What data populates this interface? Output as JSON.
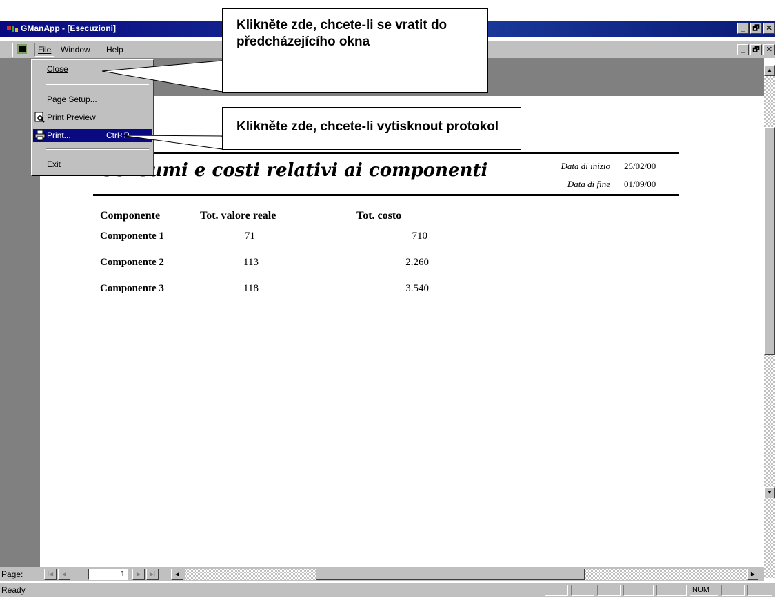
{
  "window": {
    "title": "GManApp - [Esecuzioni]",
    "controls": [
      "_",
      "🗗",
      "✕"
    ]
  },
  "menubar": {
    "file": "File",
    "window": "Window",
    "help": "Help"
  },
  "file_menu": {
    "close": "Close",
    "page_setup": "Page Setup...",
    "print_preview": "Print Preview",
    "print": "Print...",
    "print_shortcut": "Ctrl+P",
    "exit": "Exit"
  },
  "callouts": {
    "close_hint": "Klikněte zde, chcete-li se vratit do předcházejícího okna",
    "print_hint": "Klikněte zde, chcete-li vytisknout protokol"
  },
  "report": {
    "title": "Consumi e costi relativi ai componenti",
    "start_label": "Data di inizio",
    "start_value": "25/02/00",
    "end_label": "Data di fine",
    "end_value": "01/09/00",
    "columns": [
      "Componente",
      "Tot. valore reale",
      "Tot. costo"
    ],
    "rows": [
      {
        "name": "Componente 1",
        "value": "71",
        "cost": "710"
      },
      {
        "name": "Componente 2",
        "value": "113",
        "cost": "2.260"
      },
      {
        "name": "Componente 3",
        "value": "118",
        "cost": "3.540"
      }
    ]
  },
  "navigation": {
    "page_label": "Page:",
    "page_value": "1"
  },
  "status": {
    "text": "Ready",
    "num": "NUM"
  },
  "colors": {
    "title_bar": "#0a0a80",
    "face": "#c0c0c0",
    "client_bg": "#808080",
    "highlight": "#0a0a80"
  }
}
